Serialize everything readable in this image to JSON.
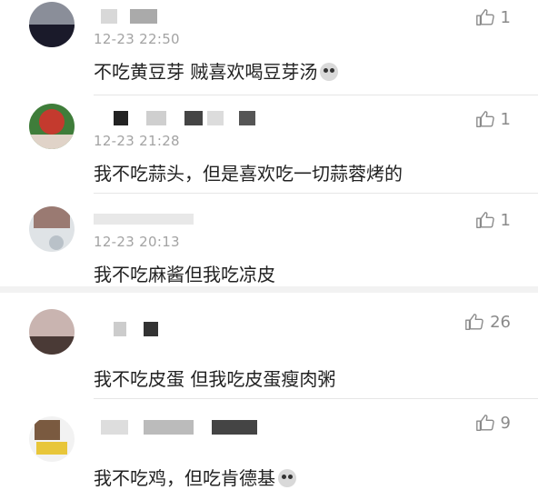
{
  "comments": [
    {
      "time": "12-23 22:50",
      "text": "不吃黄豆芽 贼喜欢喝豆芽汤",
      "likes": "1",
      "has_emoji": true,
      "avatar_colors": [
        "#8a8e99",
        "#1a1a2a"
      ]
    },
    {
      "time": "12-23 21:28",
      "text": "我不吃蒜头，但是喜欢吃一切蒜蓉烤的",
      "likes": "1",
      "has_emoji": false,
      "avatar_colors": [
        "#c43a2e",
        "#3f7d3a"
      ]
    },
    {
      "time": "12-23 20:13",
      "text": "我不吃麻酱但我吃凉皮",
      "likes": "1",
      "has_emoji": false,
      "avatar_colors": [
        "#9a7a72",
        "#dfe3e6"
      ]
    },
    {
      "time": "",
      "text": "我不吃皮蛋 但我吃皮蛋瘦肉粥",
      "likes": "26",
      "has_emoji": false,
      "avatar_colors": [
        "#c9b4b0",
        "#4a3a36"
      ]
    },
    {
      "time": "",
      "text": "我不吃鸡，但吃肯德基",
      "likes": "9",
      "has_emoji": true,
      "avatar_colors": [
        "#7a5a40",
        "#e8c63a"
      ]
    }
  ],
  "icons": {
    "like": "thumbs-up-icon",
    "emoji": "emoji-face-icon"
  }
}
